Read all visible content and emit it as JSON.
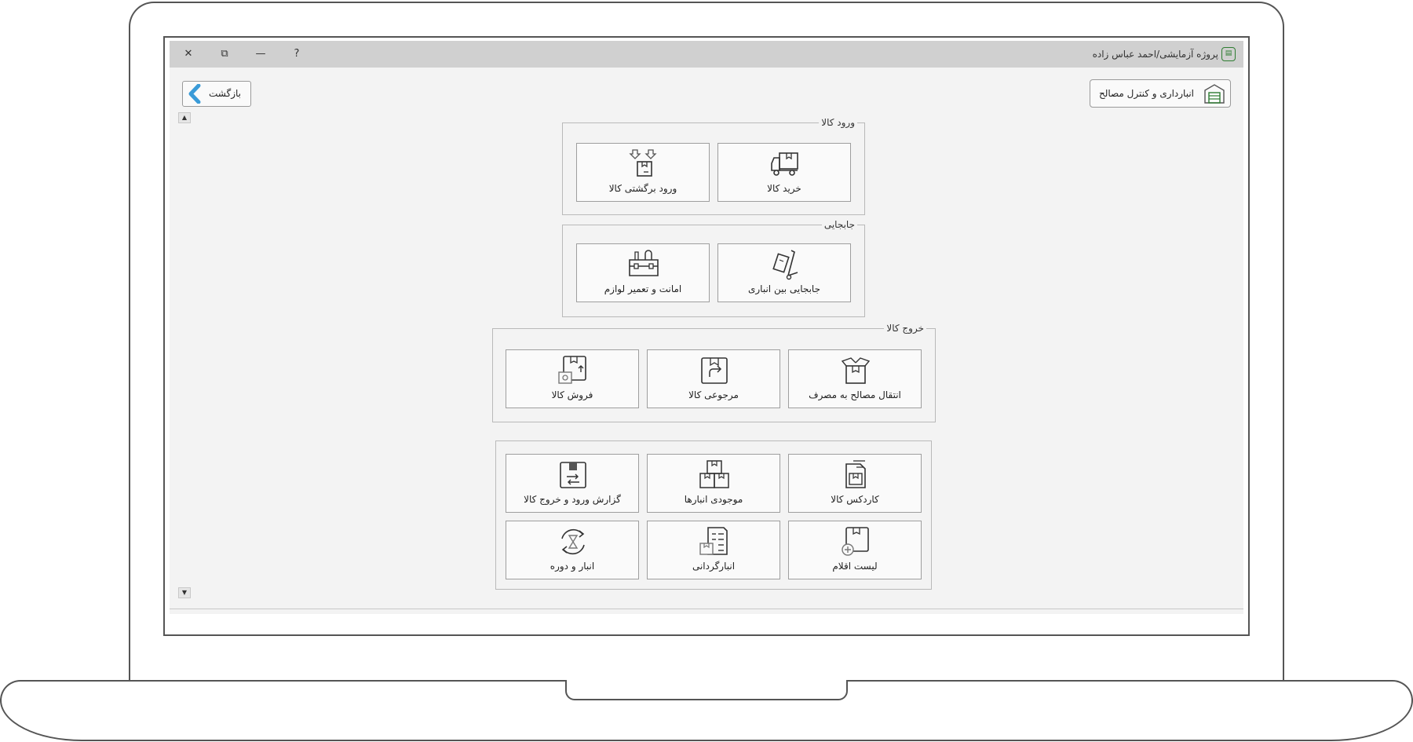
{
  "window": {
    "title": "پروژه آزمایشی/احمد عباس زاده",
    "controls": {
      "help": "?",
      "minimize": "—",
      "restore": "⧉",
      "close": "✕"
    }
  },
  "header": {
    "module_label": "انبارداری و کنترل مصالح"
  },
  "back_button": {
    "label": "بازگشت"
  },
  "scroll": {
    "up": "▲",
    "down": "▼"
  },
  "groups": {
    "goods_entry": {
      "legend": "ورود کالا",
      "tiles": [
        {
          "label": "خرید کالا",
          "icon": "truck-icon"
        },
        {
          "label": "ورود برگشتی کالا",
          "icon": "returned-box-icon"
        }
      ]
    },
    "transfer": {
      "legend": "جابجایی",
      "tiles": [
        {
          "label": "جابجایی بین انباری",
          "icon": "hand-truck-icon"
        },
        {
          "label": "امانت و تعمیر لوازم",
          "icon": "toolbox-icon"
        }
      ]
    },
    "goods_exit": {
      "legend": "خروج کالا",
      "tiles": [
        {
          "label": "انتقال مصالح به مصرف",
          "icon": "open-box-icon"
        },
        {
          "label": "مرجوعی کالا",
          "icon": "box-return-icon"
        },
        {
          "label": "فروش کالا",
          "icon": "box-sale-icon"
        }
      ]
    },
    "reports": {
      "tiles": [
        {
          "label": "کاردکس کالا",
          "icon": "cardex-icon"
        },
        {
          "label": "موجودی انبارها",
          "icon": "stacked-boxes-icon"
        },
        {
          "label": "گزارش ورود و خروج کالا",
          "icon": "exchange-report-icon"
        },
        {
          "label": "لیست اقلام",
          "icon": "item-list-icon"
        },
        {
          "label": "انبارگردانی",
          "icon": "inventory-count-icon"
        },
        {
          "label": "انبار و دوره",
          "icon": "warehouse-period-icon"
        }
      ]
    }
  },
  "colors": {
    "accent": "#3a9bd8",
    "icon_green": "#2e7d32",
    "window_bg": "#f3f3f3",
    "titlebar_bg": "#d0d0d0"
  }
}
